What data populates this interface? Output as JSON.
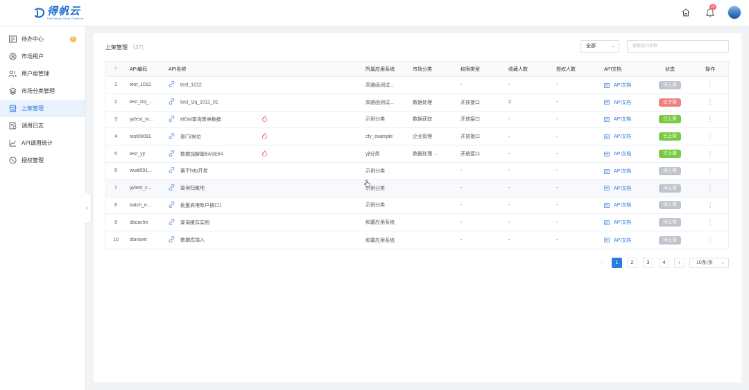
{
  "brand": {
    "name": "得帆云",
    "tagline": "DeFinesys iDeal Platform",
    "color": "#1c6fd1"
  },
  "header": {
    "home_icon": "home-icon",
    "bell_icon": "bell-icon",
    "notification_count": "22"
  },
  "sidebar": {
    "items": [
      {
        "label": "待办中心",
        "icon": "todo-list-icon",
        "badge": "5"
      },
      {
        "label": "市场用户",
        "icon": "market-user-icon"
      },
      {
        "label": "用户组管理",
        "icon": "user-group-icon"
      },
      {
        "label": "市场分类管理",
        "icon": "layers-icon"
      },
      {
        "label": "上架管理",
        "icon": "store-icon",
        "active": true
      },
      {
        "label": "调用日志",
        "icon": "log-icon"
      },
      {
        "label": "API调用统计",
        "icon": "chart-icon"
      },
      {
        "label": "授权管理",
        "icon": "shield-icon"
      }
    ]
  },
  "main": {
    "title": "上架管理",
    "count": "（37）",
    "filter_value": "全部",
    "search_placeholder": "搜索接口名称",
    "columns": {
      "idx": "#",
      "code": "API编码",
      "name": "API名称",
      "sys": "所属应用系统",
      "cat": "市场分类",
      "perm": "权限类型",
      "fav": "收藏人数",
      "auth": "授权人数",
      "doc": "API文档",
      "status": "状态",
      "op": "操作"
    },
    "rows": [
      {
        "idx": "1",
        "code": "test_1012",
        "name": "test_1012",
        "hot": false,
        "sys": "高雅函测试...",
        "cat": "",
        "perm": "-",
        "fav": "-",
        "auth": "-",
        "doc": "API文档",
        "status": "待上架",
        "status_color": "#c0c4cc"
      },
      {
        "idx": "2",
        "code": "test_lzq_...",
        "name": "test_lzq_1011_01",
        "hot": false,
        "sys": "高雅函测试...",
        "cat": "数据处理",
        "perm": "开放接口",
        "fav": "2",
        "auth": "-",
        "doc": "API文档",
        "status": "已下架",
        "status_color": "#f08080"
      },
      {
        "idx": "3",
        "code": "yj/test_m...",
        "name": "MDM查询表单数据",
        "hot": true,
        "sys": "示例分类",
        "cat": "数据获取",
        "perm": "开放接口",
        "fav": "-",
        "auth": "-",
        "doc": "API文档",
        "status": "已上架",
        "status_color": "#7ac943"
      },
      {
        "idx": "4",
        "code": "test09091",
        "name": "部门/岗位",
        "hot": true,
        "sys": "cfy_example",
        "cat": "企业管理",
        "perm": "开放接口",
        "fav": "-",
        "auth": "-",
        "doc": "API文档",
        "status": "已上架",
        "status_color": "#7ac943"
      },
      {
        "idx": "5",
        "code": "test_yjl",
        "name": "数据加解密BASE64",
        "hot": true,
        "sys": "yjl分类",
        "cat": "数据处理 ...",
        "perm": "开放接口",
        "fav": "-",
        "auth": "-",
        "doc": "API文档",
        "status": "已上架",
        "status_color": "#7ac943"
      },
      {
        "idx": "6",
        "code": "wudi091...",
        "name": "基于http开发",
        "hot": false,
        "sys": "示例分类",
        "cat": "",
        "perm": "-",
        "fav": "-",
        "auth": "-",
        "doc": "API文档",
        "status": "待上架",
        "status_color": "#c0c4cc"
      },
      {
        "idx": "7",
        "code": "yj/test_c...",
        "name": "查询归属地",
        "hot": false,
        "sys": "示例分类",
        "cat": "",
        "perm": "-",
        "fav": "-",
        "auth": "-",
        "doc": "API文档",
        "status": "待上架",
        "status_color": "#c0c4cc"
      },
      {
        "idx": "8",
        "code": "batch_e...",
        "name": "批量启用账户接口1",
        "hot": false,
        "sys": "示例分类",
        "cat": "",
        "perm": "-",
        "fav": "-",
        "auth": "-",
        "doc": "API文档",
        "status": "待上架",
        "status_color": "#c0c4cc"
      },
      {
        "idx": "9",
        "code": "dbcache",
        "name": "查询缓存实例",
        "hot": false,
        "sys": "和蕾应用系统",
        "cat": "",
        "perm": "-",
        "fav": "-",
        "auth": "-",
        "doc": "API文档",
        "status": "待上架",
        "status_color": "#c0c4cc"
      },
      {
        "idx": "10",
        "code": "dbinsert",
        "name": "数据库插入",
        "hot": false,
        "sys": "和蕾应用系统",
        "cat": "",
        "perm": "-",
        "fav": "-",
        "auth": "-",
        "doc": "API文档",
        "status": "待上架",
        "status_color": "#c0c4cc"
      }
    ]
  },
  "pagination": {
    "prev": "‹",
    "next": "›",
    "pages": [
      "1",
      "2",
      "3",
      "4"
    ],
    "current": "1",
    "page_size": "10条/页"
  },
  "colors": {
    "accent": "#2a7ae4",
    "published": "#7ac943",
    "offline": "#f08080",
    "pending": "#c0c4cc"
  }
}
